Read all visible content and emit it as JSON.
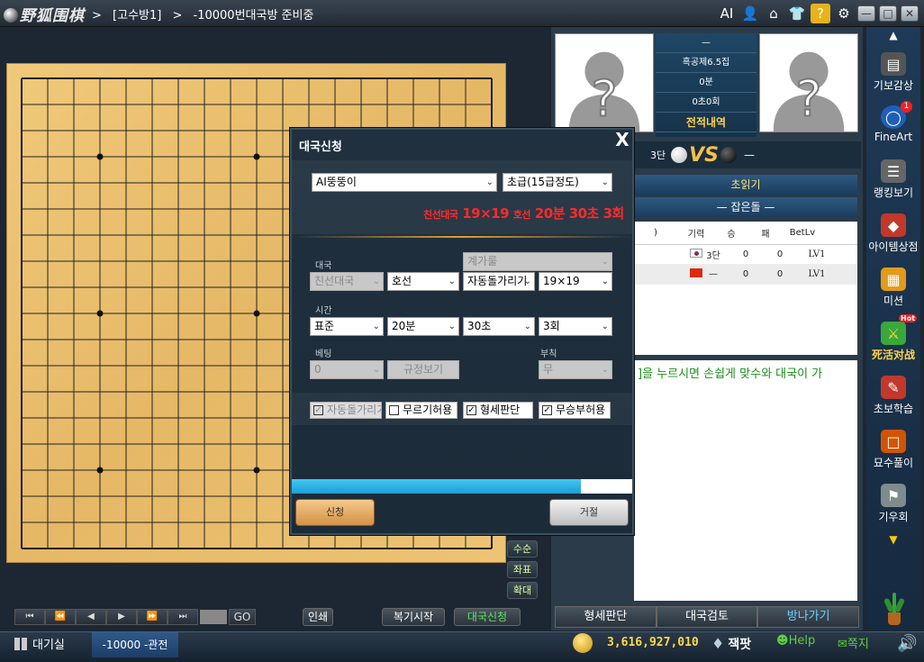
{
  "app": {
    "logo": "野狐围棋"
  },
  "breadcrumb": {
    "room": "[고수방1]",
    "sep": ">",
    "status": "-10000번대국방 준비중"
  },
  "top_icons": [
    "AI",
    "person-icon",
    "home-icon",
    "shirt-icon",
    "help-icon",
    "gear-icon",
    "minimize-icon",
    "maximize-icon",
    "close-icon"
  ],
  "top_labels": {
    "ai": "AI",
    "help": "?"
  },
  "board": {
    "size": 19,
    "stars": [
      [
        3,
        3
      ],
      [
        3,
        9
      ],
      [
        3,
        15
      ],
      [
        9,
        3
      ],
      [
        9,
        9
      ],
      [
        9,
        15
      ],
      [
        15,
        3
      ],
      [
        15,
        9
      ],
      [
        15,
        15
      ]
    ]
  },
  "side_buttons": [
    "수순",
    "좌표",
    "확대"
  ],
  "nav": {
    "first": "⏮",
    "prev10": "⏪",
    "prev": "◀",
    "next": "▶",
    "next10": "⏩",
    "last": "⏭",
    "go": "GO",
    "print": "인쇄",
    "review": "복기시작",
    "challenge": "대국신청"
  },
  "status_bar": {
    "lobby": "대기실",
    "tab": "-10000 -관전",
    "money": "3,616,927,010",
    "jackpot": "잭팟",
    "help": "Help",
    "message": "쪽지"
  },
  "players": {
    "info_rows": [
      "—",
      "흑공제6.5집",
      "0분",
      "0초0회",
      "전적내역"
    ],
    "left_rank": "3단",
    "right_name": "—",
    "vs": "VS"
  },
  "tabs": {
    "tab1": "초읽기",
    "tab2": "— 잡은돌 —"
  },
  "player_table": {
    "headers": [
      ")",
      "기력",
      "승",
      "패",
      "BetLv"
    ],
    "rows": [
      {
        "flag": "KR",
        "rank": "3단",
        "win": "0",
        "loss": "0",
        "bet": "LV1"
      },
      {
        "flag": "CN",
        "rank": "—",
        "win": "0",
        "loss": "0",
        "bet": "LV1"
      }
    ]
  },
  "chat": {
    "text": "]을 누르시면 손쉽게 맞수와 대국이 가"
  },
  "right_tabs": [
    "형세판단",
    "대국검토",
    "방나가기"
  ],
  "menu": [
    {
      "label": "기보감상",
      "icon": "book-icon"
    },
    {
      "label": "FineArt",
      "icon": "fineart-icon",
      "badge": "1"
    },
    {
      "label": "랭킹보기",
      "icon": "ranking-icon"
    },
    {
      "label": "아이템상점",
      "icon": "gem-icon"
    },
    {
      "label": "미션",
      "icon": "mission-icon"
    },
    {
      "label": "死活对战",
      "icon": "swords-icon",
      "badge": "Hot"
    },
    {
      "label": "초보학습",
      "icon": "learn-icon"
    },
    {
      "label": "묘수풀이",
      "icon": "puzzle-icon"
    },
    {
      "label": "기우회",
      "icon": "club-icon"
    }
  ],
  "dialog": {
    "title": "대국신청",
    "close": "X",
    "opponent": "AI뚱뚱이",
    "level": "초급(15급정도)",
    "summary_a": "친선대국",
    "summary_b": "19×19",
    "summary_c": "호선",
    "summary_d": "20분",
    "summary_e": "30초",
    "summary_f": "3회",
    "label_game": "대국",
    "label_count": "계가룰",
    "game_type": "친선대국",
    "handicap": "호선",
    "color_rule": "자동돌가리기",
    "board_size": "19×19",
    "label_time": "시간",
    "time_mode": "표준",
    "main_time": "20분",
    "byoyomi": "30초",
    "periods": "3회",
    "label_bet": "베팅",
    "label_rule": "부칙",
    "bet": "0",
    "rules_button": "규정보기",
    "rule": "무",
    "checks": [
      {
        "label": "자동돌가리기",
        "checked": true,
        "disabled": true
      },
      {
        "label": "무르기허용",
        "checked": false,
        "disabled": false
      },
      {
        "label": "형세판단",
        "checked": true,
        "disabled": false
      },
      {
        "label": "무승부허용",
        "checked": true,
        "disabled": false
      }
    ],
    "progress": 0.85,
    "apply": "신청",
    "reject": "거절"
  },
  "colors": {
    "accent": "#ffcc00",
    "summary": "#ff2a2a",
    "chat": "#1b8f1b"
  }
}
